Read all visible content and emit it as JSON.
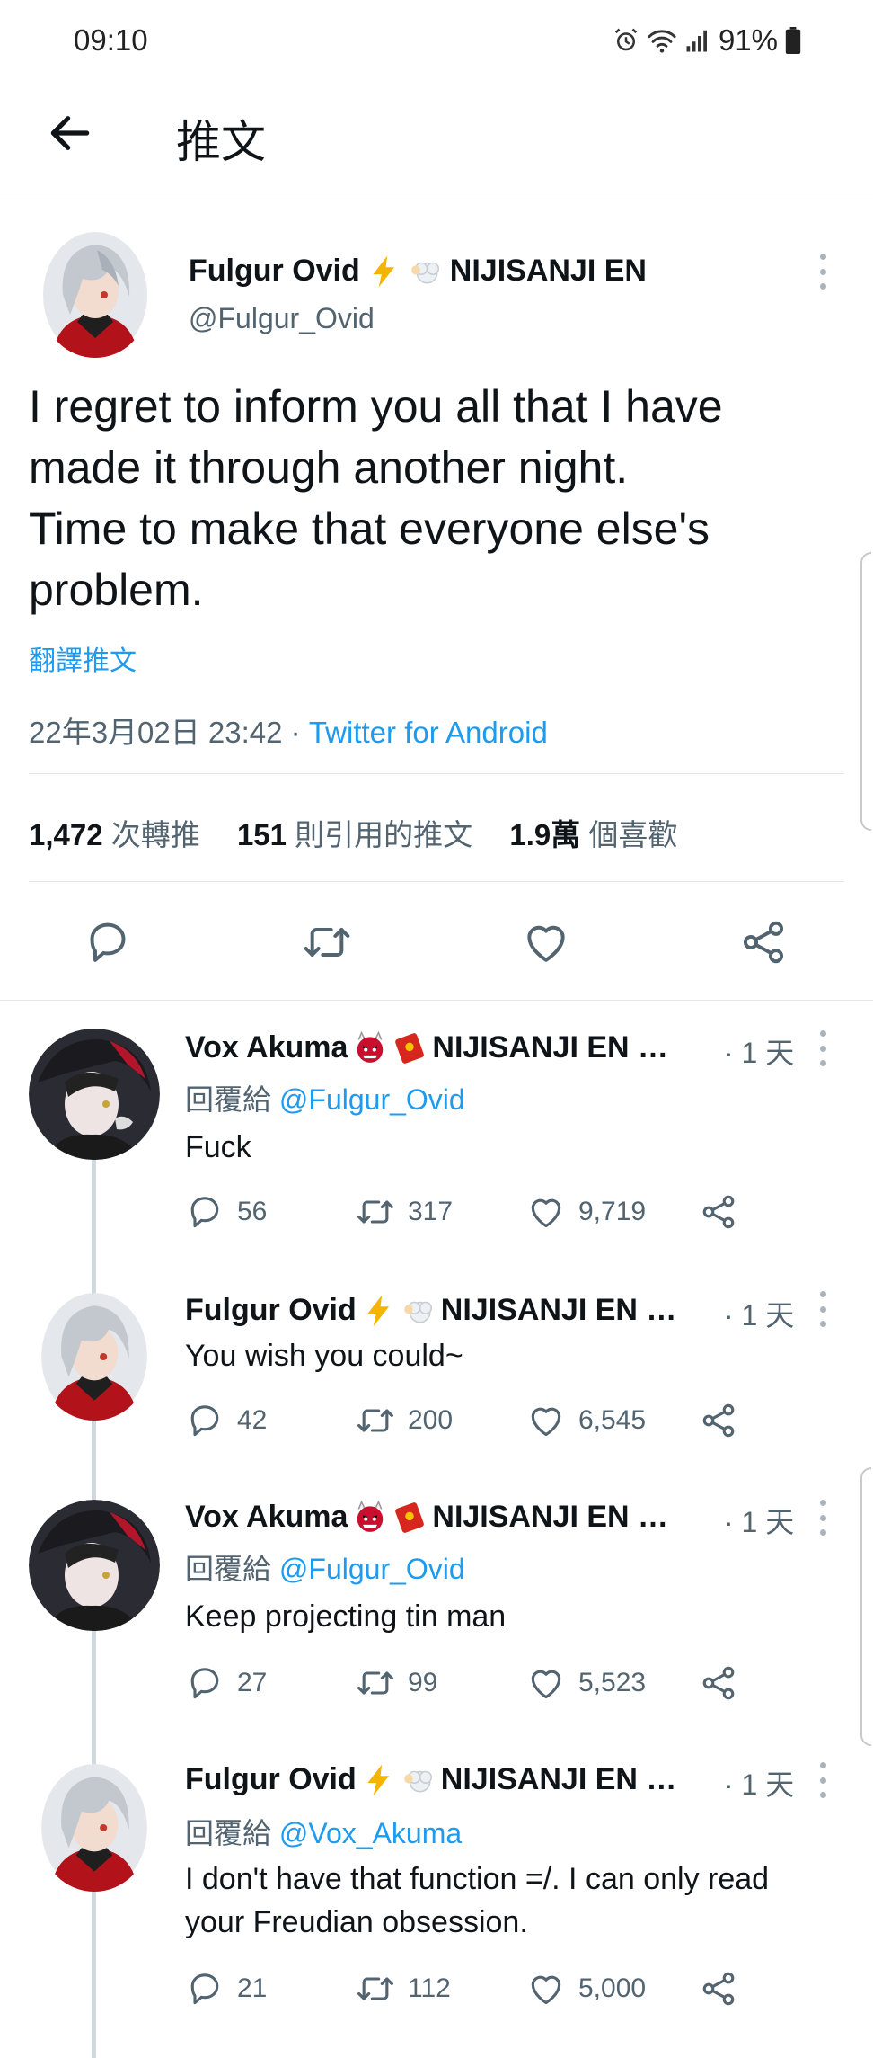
{
  "status": {
    "time": "09:10",
    "battery": "91%"
  },
  "header": {
    "title": "推文"
  },
  "main": {
    "name": "Fulgur Ovid",
    "org": "NIJISANJI EN",
    "handle": "@Fulgur_Ovid",
    "text_lines": [
      "I regret to inform you all that I have",
      "made it through another night.",
      "Time to make that everyone else's",
      "problem."
    ],
    "translate": "翻譯推文",
    "timestamp": "22年3月02日 23:42",
    "dot": " · ",
    "source": "Twitter for Android",
    "stats": [
      {
        "value": "1,472",
        "label": "次轉推"
      },
      {
        "value": "151",
        "label": "則引用的推文"
      },
      {
        "value": "1.9萬",
        "label": "個喜歡"
      }
    ]
  },
  "replies": [
    {
      "name": "Vox Akuma",
      "org": "NIJISANJI EN …",
      "time": "· 1 天",
      "reply_prefix": "回覆給",
      "reply_to": "@Fulgur_Ovid",
      "text": "Fuck",
      "replies": "56",
      "retweets": "317",
      "likes": "9,719"
    },
    {
      "name": "Fulgur Ovid",
      "org": "NIJISANJI EN …",
      "time": "· 1 天",
      "text": "You wish you could~",
      "replies": "42",
      "retweets": "200",
      "likes": "6,545"
    },
    {
      "name": "Vox Akuma",
      "org": "NIJISANJI EN …",
      "time": "· 1 天",
      "reply_prefix": "回覆給",
      "reply_to": "@Fulgur_Ovid",
      "text": "Keep projecting tin man",
      "replies": "27",
      "retweets": "99",
      "likes": "5,523"
    },
    {
      "name": "Fulgur Ovid",
      "org": "NIJISANJI EN …",
      "time": "· 1 天",
      "reply_prefix": "回覆給",
      "reply_to": "@Vox_Akuma",
      "text_lines": [
        "I don't have that function =/. I can only read",
        "your Freudian obsession."
      ],
      "replies": "21",
      "retweets": "112",
      "likes": "5,000"
    }
  ],
  "icons": {
    "back": "arrow-left-icon",
    "reply": "reply-icon",
    "retweet": "retweet-icon",
    "like": "heart-icon",
    "share": "share-icon",
    "more": "more-vertical-icon",
    "bolt": "lightning-icon",
    "sheep": "sheep-icon",
    "oni": "oni-mask-icon",
    "envelope": "red-envelope-icon"
  },
  "colors": {
    "link": "#1d9bf0",
    "text": "#0f1419",
    "muted": "#536471",
    "bolt": "#f5b400",
    "oni": "#c8102e"
  }
}
